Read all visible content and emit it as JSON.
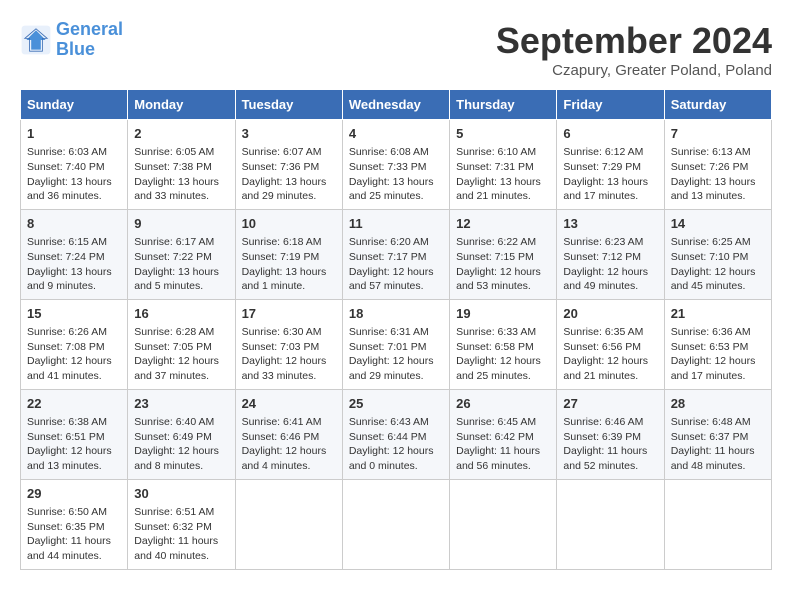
{
  "header": {
    "logo_line1": "General",
    "logo_line2": "Blue",
    "month_title": "September 2024",
    "subtitle": "Czapury, Greater Poland, Poland"
  },
  "weekdays": [
    "Sunday",
    "Monday",
    "Tuesday",
    "Wednesday",
    "Thursday",
    "Friday",
    "Saturday"
  ],
  "weeks": [
    [
      {
        "day": 1,
        "info": "Sunrise: 6:03 AM\nSunset: 7:40 PM\nDaylight: 13 hours\nand 36 minutes."
      },
      {
        "day": 2,
        "info": "Sunrise: 6:05 AM\nSunset: 7:38 PM\nDaylight: 13 hours\nand 33 minutes."
      },
      {
        "day": 3,
        "info": "Sunrise: 6:07 AM\nSunset: 7:36 PM\nDaylight: 13 hours\nand 29 minutes."
      },
      {
        "day": 4,
        "info": "Sunrise: 6:08 AM\nSunset: 7:33 PM\nDaylight: 13 hours\nand 25 minutes."
      },
      {
        "day": 5,
        "info": "Sunrise: 6:10 AM\nSunset: 7:31 PM\nDaylight: 13 hours\nand 21 minutes."
      },
      {
        "day": 6,
        "info": "Sunrise: 6:12 AM\nSunset: 7:29 PM\nDaylight: 13 hours\nand 17 minutes."
      },
      {
        "day": 7,
        "info": "Sunrise: 6:13 AM\nSunset: 7:26 PM\nDaylight: 13 hours\nand 13 minutes."
      }
    ],
    [
      {
        "day": 8,
        "info": "Sunrise: 6:15 AM\nSunset: 7:24 PM\nDaylight: 13 hours\nand 9 minutes."
      },
      {
        "day": 9,
        "info": "Sunrise: 6:17 AM\nSunset: 7:22 PM\nDaylight: 13 hours\nand 5 minutes."
      },
      {
        "day": 10,
        "info": "Sunrise: 6:18 AM\nSunset: 7:19 PM\nDaylight: 13 hours\nand 1 minute."
      },
      {
        "day": 11,
        "info": "Sunrise: 6:20 AM\nSunset: 7:17 PM\nDaylight: 12 hours\nand 57 minutes."
      },
      {
        "day": 12,
        "info": "Sunrise: 6:22 AM\nSunset: 7:15 PM\nDaylight: 12 hours\nand 53 minutes."
      },
      {
        "day": 13,
        "info": "Sunrise: 6:23 AM\nSunset: 7:12 PM\nDaylight: 12 hours\nand 49 minutes."
      },
      {
        "day": 14,
        "info": "Sunrise: 6:25 AM\nSunset: 7:10 PM\nDaylight: 12 hours\nand 45 minutes."
      }
    ],
    [
      {
        "day": 15,
        "info": "Sunrise: 6:26 AM\nSunset: 7:08 PM\nDaylight: 12 hours\nand 41 minutes."
      },
      {
        "day": 16,
        "info": "Sunrise: 6:28 AM\nSunset: 7:05 PM\nDaylight: 12 hours\nand 37 minutes."
      },
      {
        "day": 17,
        "info": "Sunrise: 6:30 AM\nSunset: 7:03 PM\nDaylight: 12 hours\nand 33 minutes."
      },
      {
        "day": 18,
        "info": "Sunrise: 6:31 AM\nSunset: 7:01 PM\nDaylight: 12 hours\nand 29 minutes."
      },
      {
        "day": 19,
        "info": "Sunrise: 6:33 AM\nSunset: 6:58 PM\nDaylight: 12 hours\nand 25 minutes."
      },
      {
        "day": 20,
        "info": "Sunrise: 6:35 AM\nSunset: 6:56 PM\nDaylight: 12 hours\nand 21 minutes."
      },
      {
        "day": 21,
        "info": "Sunrise: 6:36 AM\nSunset: 6:53 PM\nDaylight: 12 hours\nand 17 minutes."
      }
    ],
    [
      {
        "day": 22,
        "info": "Sunrise: 6:38 AM\nSunset: 6:51 PM\nDaylight: 12 hours\nand 13 minutes."
      },
      {
        "day": 23,
        "info": "Sunrise: 6:40 AM\nSunset: 6:49 PM\nDaylight: 12 hours\nand 8 minutes."
      },
      {
        "day": 24,
        "info": "Sunrise: 6:41 AM\nSunset: 6:46 PM\nDaylight: 12 hours\nand 4 minutes."
      },
      {
        "day": 25,
        "info": "Sunrise: 6:43 AM\nSunset: 6:44 PM\nDaylight: 12 hours\nand 0 minutes."
      },
      {
        "day": 26,
        "info": "Sunrise: 6:45 AM\nSunset: 6:42 PM\nDaylight: 11 hours\nand 56 minutes."
      },
      {
        "day": 27,
        "info": "Sunrise: 6:46 AM\nSunset: 6:39 PM\nDaylight: 11 hours\nand 52 minutes."
      },
      {
        "day": 28,
        "info": "Sunrise: 6:48 AM\nSunset: 6:37 PM\nDaylight: 11 hours\nand 48 minutes."
      }
    ],
    [
      {
        "day": 29,
        "info": "Sunrise: 6:50 AM\nSunset: 6:35 PM\nDaylight: 11 hours\nand 44 minutes."
      },
      {
        "day": 30,
        "info": "Sunrise: 6:51 AM\nSunset: 6:32 PM\nDaylight: 11 hours\nand 40 minutes."
      },
      null,
      null,
      null,
      null,
      null
    ]
  ]
}
